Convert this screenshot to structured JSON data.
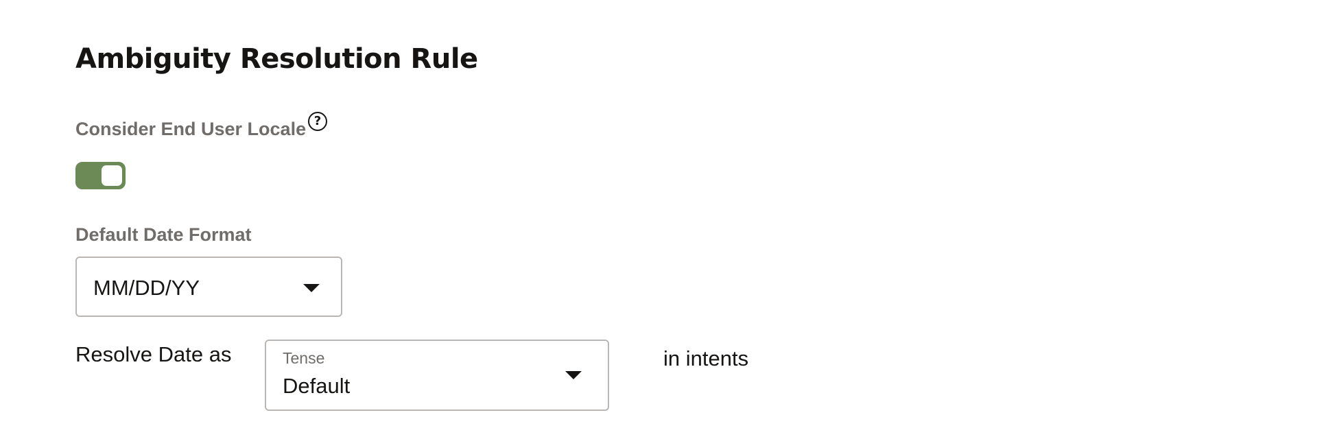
{
  "section": {
    "title": "Ambiguity Resolution Rule"
  },
  "locale": {
    "label": "Consider End User Locale",
    "help_icon": "question-circle-icon",
    "toggle_on": true,
    "toggle_color": "#6b8a56"
  },
  "date_format": {
    "label": "Default Date Format",
    "selected": "MM/DD/YY",
    "caret_icon": "caret-down-icon"
  },
  "resolve": {
    "prefix": "Resolve Date as",
    "tense_label": "Tense",
    "tense_selected": "Default",
    "suffix": "in intents"
  }
}
